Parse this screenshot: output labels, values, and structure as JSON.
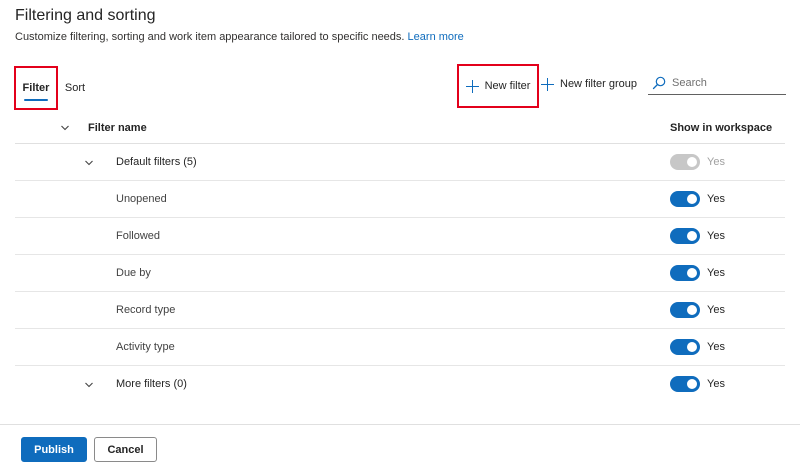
{
  "page": {
    "title": "Filtering and sorting",
    "description": "Customize filtering, sorting and work item appearance tailored to specific needs.",
    "learn_more": "Learn more"
  },
  "tabs": [
    {
      "label": "Filter",
      "selected": true
    },
    {
      "label": "Sort",
      "selected": false
    }
  ],
  "toolbar": {
    "new_filter_label": "New filter",
    "new_filter_group_label": "New filter group",
    "search_placeholder": "Search"
  },
  "table": {
    "col_filter_name": "Filter name",
    "col_show": "Show in workspace",
    "rows": [
      {
        "label": "Default filters (5)",
        "kind": "group",
        "toggle_on": true,
        "toggle_disabled": true,
        "toggle_text": "Yes"
      },
      {
        "label": "Unopened",
        "kind": "child",
        "toggle_on": true,
        "toggle_disabled": false,
        "toggle_text": "Yes"
      },
      {
        "label": "Followed",
        "kind": "child",
        "toggle_on": true,
        "toggle_disabled": false,
        "toggle_text": "Yes"
      },
      {
        "label": "Due by",
        "kind": "child",
        "toggle_on": true,
        "toggle_disabled": false,
        "toggle_text": "Yes"
      },
      {
        "label": "Record type",
        "kind": "child",
        "toggle_on": true,
        "toggle_disabled": false,
        "toggle_text": "Yes"
      },
      {
        "label": "Activity type",
        "kind": "child",
        "toggle_on": true,
        "toggle_disabled": false,
        "toggle_text": "Yes"
      },
      {
        "label": "More filters (0)",
        "kind": "group",
        "toggle_on": true,
        "toggle_disabled": false,
        "toggle_text": "Yes"
      }
    ]
  },
  "footer": {
    "publish_label": "Publish",
    "cancel_label": "Cancel"
  },
  "colors": {
    "accent": "#0f6cbd",
    "highlight_box": "#e3001b",
    "toggle_disabled": "#c7c7c7"
  },
  "icons": {
    "new_filter": "plus-icon",
    "new_filter_group": "plus-icon",
    "search": "search-icon",
    "expand": "chevron-down-icon"
  }
}
